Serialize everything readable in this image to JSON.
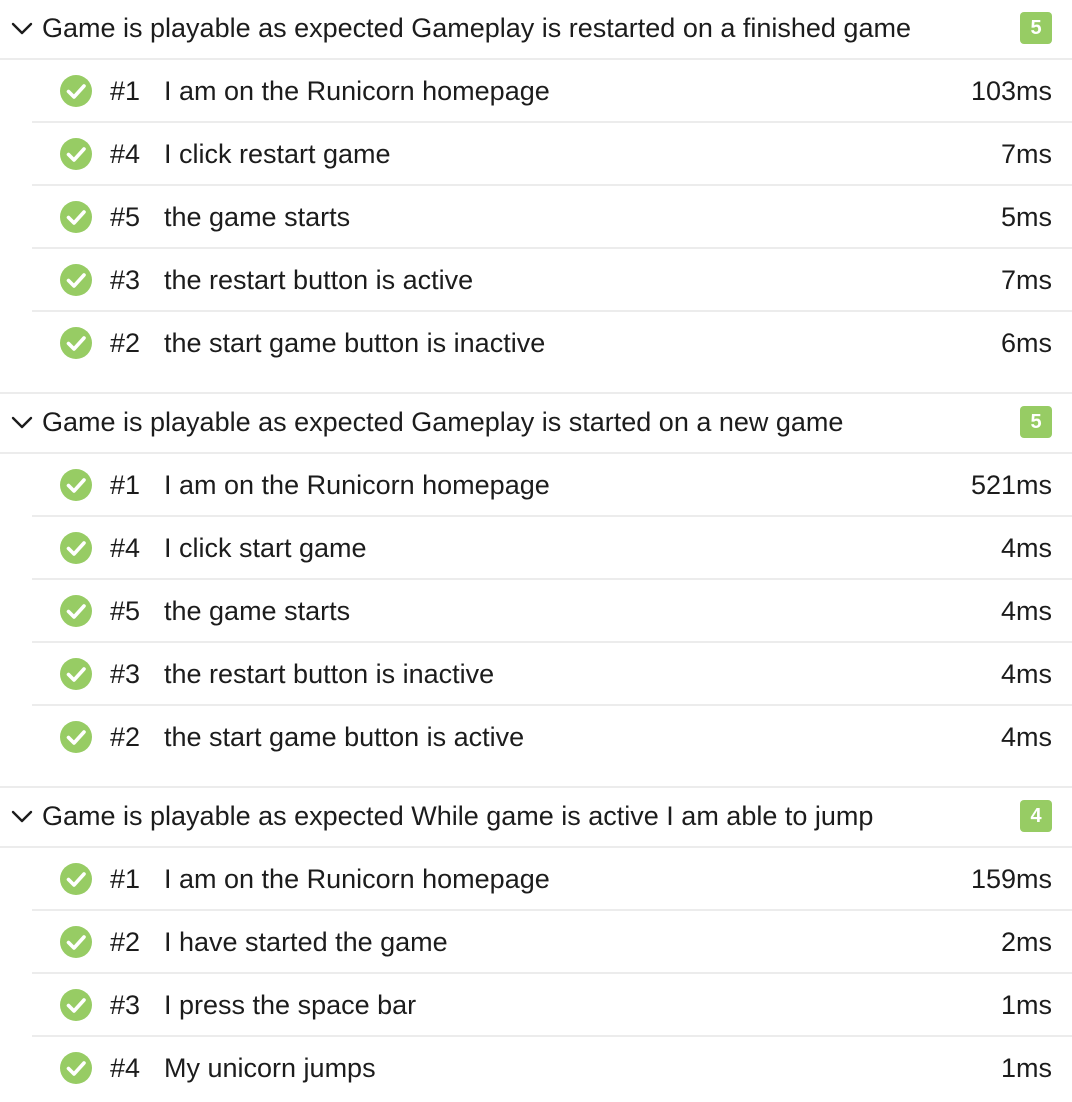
{
  "colors": {
    "pass": "#97cc64",
    "badge": "#97cc64",
    "divider": "#ececec",
    "text": "#1c1c1c"
  },
  "groups": [
    {
      "title": "Game is playable as expected Gameplay is restarted on a finished game",
      "count": "5",
      "steps": [
        {
          "num": "#1",
          "label": "I am on the Runicorn homepage",
          "duration": "103ms",
          "status": "passed"
        },
        {
          "num": "#4",
          "label": "I click restart game",
          "duration": "7ms",
          "status": "passed"
        },
        {
          "num": "#5",
          "label": "the game starts",
          "duration": "5ms",
          "status": "passed"
        },
        {
          "num": "#3",
          "label": "the restart button is active",
          "duration": "7ms",
          "status": "passed"
        },
        {
          "num": "#2",
          "label": "the start game button is inactive",
          "duration": "6ms",
          "status": "passed"
        }
      ]
    },
    {
      "title": "Game is playable as expected Gameplay is started on a new game",
      "count": "5",
      "steps": [
        {
          "num": "#1",
          "label": "I am on the Runicorn homepage",
          "duration": "521ms",
          "status": "passed"
        },
        {
          "num": "#4",
          "label": "I click start game",
          "duration": "4ms",
          "status": "passed"
        },
        {
          "num": "#5",
          "label": "the game starts",
          "duration": "4ms",
          "status": "passed"
        },
        {
          "num": "#3",
          "label": "the restart button is inactive",
          "duration": "4ms",
          "status": "passed"
        },
        {
          "num": "#2",
          "label": "the start game button is active",
          "duration": "4ms",
          "status": "passed"
        }
      ]
    },
    {
      "title": "Game is playable as expected While game is active I am able to jump",
      "count": "4",
      "steps": [
        {
          "num": "#1",
          "label": "I am on the Runicorn homepage",
          "duration": "159ms",
          "status": "passed"
        },
        {
          "num": "#2",
          "label": "I have started the game",
          "duration": "2ms",
          "status": "passed"
        },
        {
          "num": "#3",
          "label": "I press the space bar",
          "duration": "1ms",
          "status": "passed"
        },
        {
          "num": "#4",
          "label": "My unicorn jumps",
          "duration": "1ms",
          "status": "passed"
        }
      ]
    }
  ]
}
